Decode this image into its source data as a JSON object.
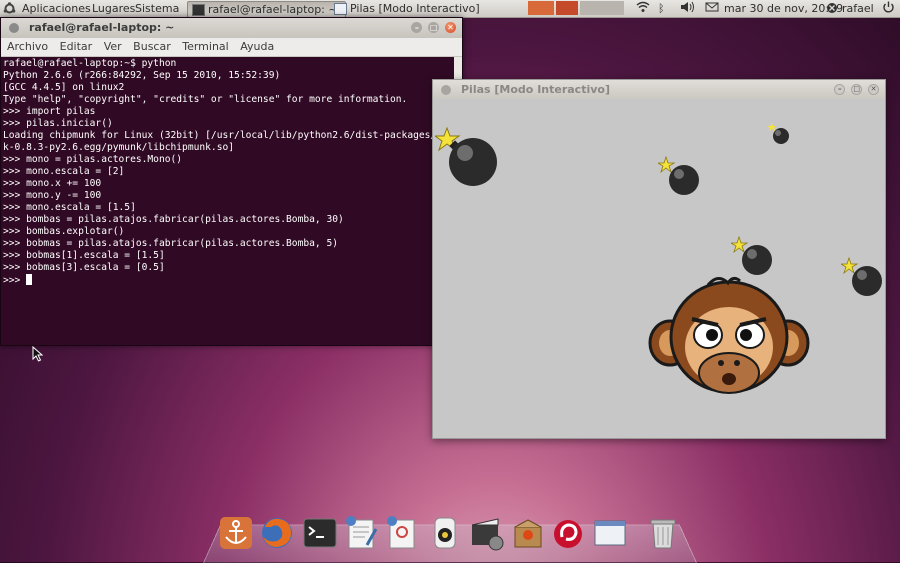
{
  "panel": {
    "menus": [
      "Aplicaciones",
      "Lugares",
      "Sistema"
    ],
    "tasks": [
      {
        "label": "rafael@rafael-laptop: ~",
        "active": true
      },
      {
        "label": "Pilas [Modo Interactivo]",
        "active": false
      }
    ],
    "clock": "mar 30 de nov, 20:19",
    "user": "rafael",
    "tray_icons": [
      "wifi-icon",
      "bluetooth-icon",
      "volume-icon",
      "mail-icon",
      "user-status-icon",
      "power-icon"
    ]
  },
  "terminal": {
    "title": "rafael@rafael-laptop: ~",
    "menu": [
      "Archivo",
      "Editar",
      "Ver",
      "Buscar",
      "Terminal",
      "Ayuda"
    ],
    "lines": [
      "rafael@rafael-laptop:~$ python",
      "Python 2.6.6 (r266:84292, Sep 15 2010, 15:52:39)",
      "[GCC 4.4.5] on linux2",
      "Type \"help\", \"copyright\", \"credits\" or \"license\" for more information.",
      ">>> import pilas",
      ">>> pilas.iniciar()",
      "Loading chipmunk for Linux (32bit) [/usr/local/lib/python2.6/dist-packages/py",
      "k-0.8.3-py2.6.egg/pymunk/libchipmunk.so]",
      ">>> mono = pilas.actores.Mono()",
      ">>> mono.escala = [2]",
      ">>> mono.x += 100",
      ">>> mono.y -= 100",
      ">>> mono.escala = [1.5]",
      ">>> bombas = pilas.atajos.fabricar(pilas.actores.Bomba, 30)",
      ">>> bombas.explotar()",
      ">>> bobmas = pilas.atajos.fabricar(pilas.actores.Bomba, 5)",
      ">>> bobmas[1].escala = [1.5]",
      ">>> bobmas[3].escala = [0.5]"
    ],
    "prompt": ">>> "
  },
  "pilas": {
    "title": "Pilas [Modo Interactivo]",
    "bombs": 5,
    "monkey": "mono"
  },
  "dock": {
    "icons": [
      "anchor-icon",
      "firefox-icon",
      "terminal-icon",
      "text-editor-icon",
      "document-viewer-icon",
      "media-player-icon",
      "movie-editor-icon",
      "package-manager-icon",
      "debian-swirl-icon",
      "window-icon",
      "trash-icon"
    ]
  },
  "colors": {
    "terminal_bg": "#300a24",
    "panel_bg": "#dcd9d4",
    "pilas_canvas": "#c7c7c7"
  }
}
